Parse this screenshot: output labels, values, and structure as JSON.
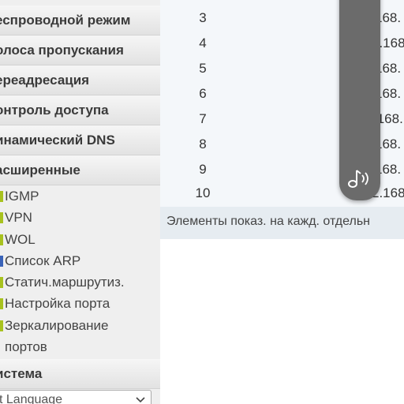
{
  "sidebar": {
    "sections": [
      {
        "label": "еспроводной режим"
      },
      {
        "label": "олоса пропускания"
      },
      {
        "label": "ереадресация"
      },
      {
        "label": "онтроль доступа"
      },
      {
        "label": "инамический DNS"
      },
      {
        "label": "асширенные"
      }
    ],
    "advanced_items": [
      {
        "label": "IGMP",
        "color": "#a8c21f"
      },
      {
        "label": "VPN",
        "color": "#a8c21f"
      },
      {
        "label": "WOL",
        "color": "#a8c21f"
      },
      {
        "label": "Список ARP",
        "color": "#3a63b8"
      },
      {
        "label": "Статич.маршрутиз.",
        "color": "#a8c21f"
      },
      {
        "label": "Настройка порта",
        "color": "#a8c21f"
      },
      {
        "label": "Зеркалирование",
        "color": "#a8c21f"
      },
      {
        "label": "портов"
      }
    ],
    "system_label": "истема",
    "language_select": "t Language"
  },
  "table": {
    "rows": [
      {
        "num": "3",
        "ip": "168."
      },
      {
        "num": "4",
        "ip": "2.168."
      },
      {
        "num": "5",
        "ip": "168."
      },
      {
        "num": "6",
        "ip": "168."
      },
      {
        "num": "7",
        "ip": ".168."
      },
      {
        "num": "8",
        "ip": "168."
      },
      {
        "num": "9",
        "ip": "168."
      },
      {
        "num": "10",
        "ip": "2.168."
      }
    ]
  },
  "footer_text": "Элементы показ. на кажд. отдельн",
  "overlay": {
    "icon": "music-note-icon",
    "color": "#6b6b6b"
  }
}
